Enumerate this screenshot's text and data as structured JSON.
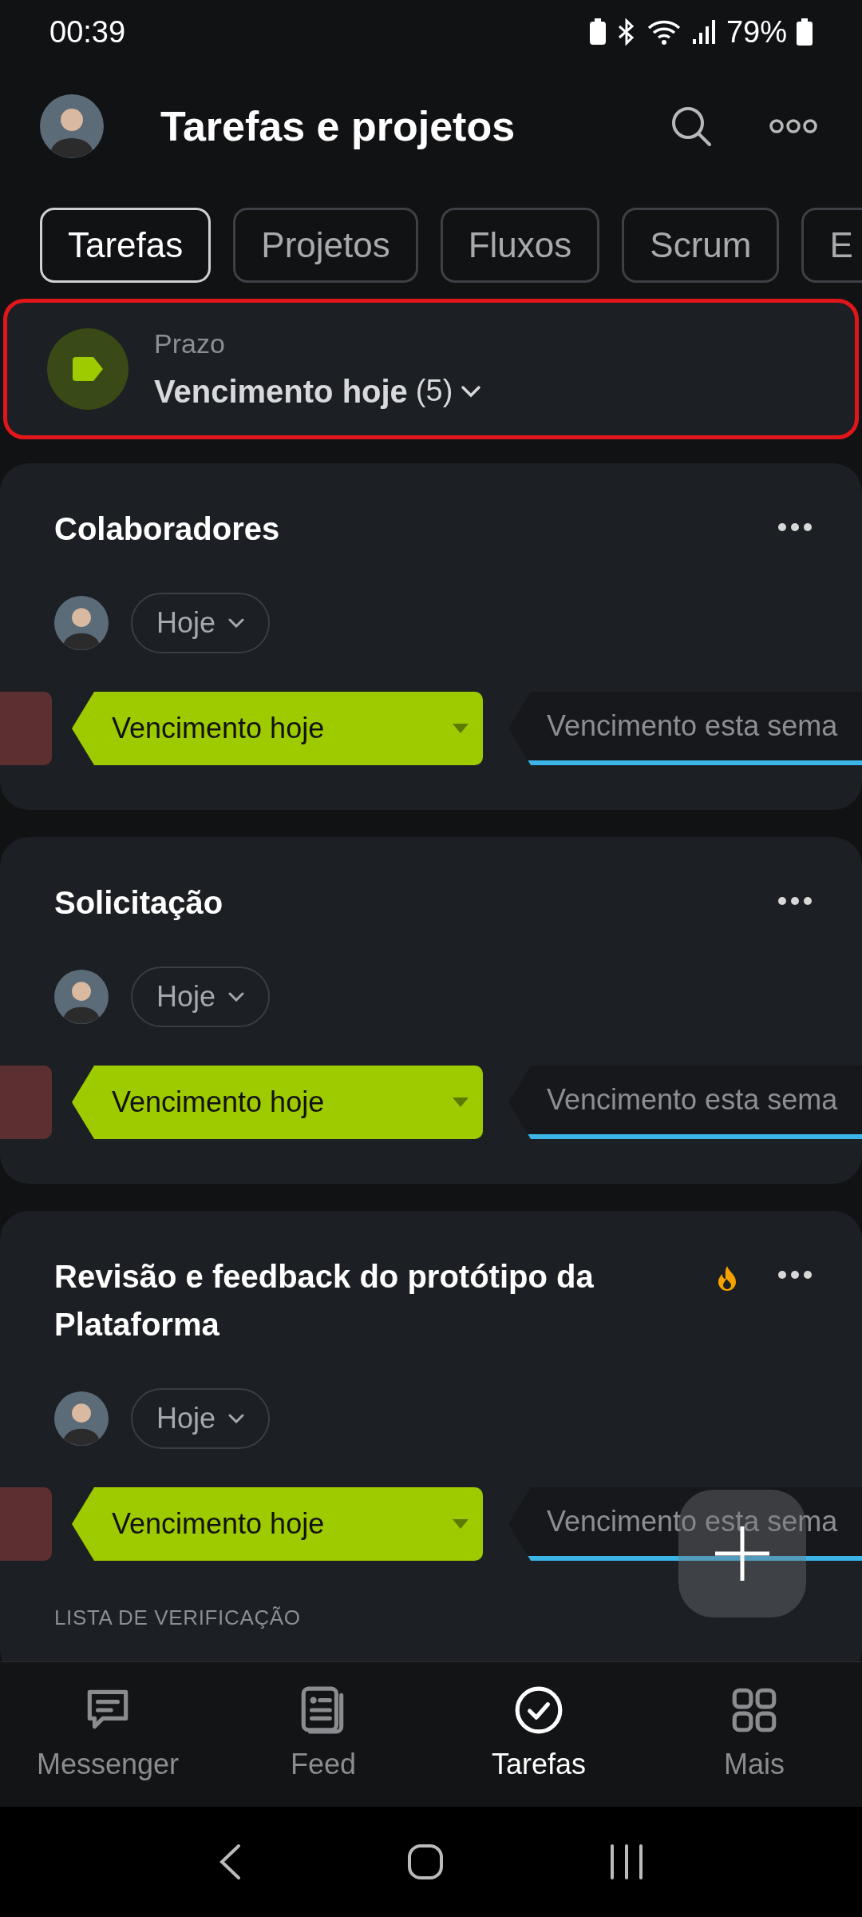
{
  "status_bar": {
    "time": "00:39",
    "battery": "79%"
  },
  "header": {
    "title": "Tarefas e projetos"
  },
  "tabs": [
    {
      "label": "Tarefas",
      "selected": true
    },
    {
      "label": "Projetos",
      "selected": false
    },
    {
      "label": "Fluxos",
      "selected": false
    },
    {
      "label": "Scrum",
      "selected": false
    },
    {
      "label": "E",
      "selected": false
    }
  ],
  "filter": {
    "label": "Prazo",
    "value": "Vencimento hoje",
    "count": "(5)"
  },
  "tasks": [
    {
      "title": "Colaboradores",
      "hot": false,
      "deadline": "Hoje",
      "stages": [
        {
          "kind": "previous"
        },
        {
          "kind": "current",
          "label": "Vencimento hoje"
        },
        {
          "kind": "next",
          "label": "Vencimento esta sema"
        }
      ]
    },
    {
      "title": "Solicitação",
      "hot": false,
      "deadline": "Hoje",
      "stages": [
        {
          "kind": "previous"
        },
        {
          "kind": "current",
          "label": "Vencimento hoje"
        },
        {
          "kind": "next",
          "label": "Vencimento esta sema"
        }
      ]
    },
    {
      "title": "Revisão e feedback do protótipo da Plataforma",
      "hot": true,
      "deadline": "Hoje",
      "stages": [
        {
          "kind": "previous"
        },
        {
          "kind": "current",
          "label": "Vencimento hoje"
        },
        {
          "kind": "next",
          "label": "Vencimento esta sema"
        }
      ],
      "section": "LISTA DE VERIFICAÇÃO"
    }
  ],
  "bottom_nav": [
    {
      "label": "Messenger",
      "kind": "chat",
      "selected": false
    },
    {
      "label": "Feed",
      "kind": "feed",
      "selected": false
    },
    {
      "label": "Tarefas",
      "kind": "check",
      "selected": true
    },
    {
      "label": "Mais",
      "kind": "grid",
      "selected": false
    }
  ]
}
